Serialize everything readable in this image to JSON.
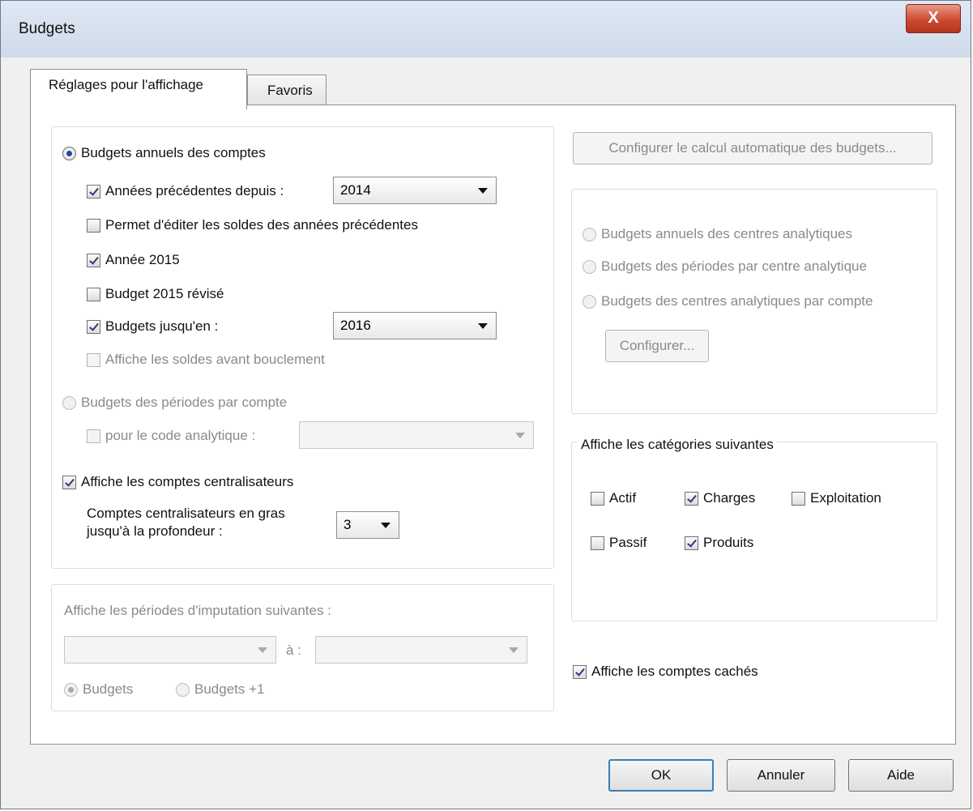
{
  "window": {
    "title": "Budgets",
    "close_label": "X"
  },
  "tabs": [
    "Réglages pour l'affichage",
    "Favoris"
  ],
  "left": {
    "annual": {
      "label": "Budgets annuels des comptes",
      "selected": true
    },
    "prev_years": {
      "label": "Années précédentes depuis :",
      "checked": true,
      "value": "2014"
    },
    "edit_prev": {
      "label": "Permet d'éditer les soldes des années précédentes",
      "checked": false
    },
    "year": {
      "label": "Année 2015",
      "checked": true
    },
    "revised": {
      "label": "Budget 2015 révisé",
      "checked": false
    },
    "until": {
      "label": "Budgets jusqu'en :",
      "checked": true,
      "value": "2016"
    },
    "before_close": {
      "label": "Affiche les soldes avant bouclement",
      "checked": false,
      "disabled": true
    },
    "periods": {
      "label": "Budgets des périodes par compte",
      "selected": false,
      "disabled": true
    },
    "analytic": {
      "label": "pour le code analytique :",
      "checked": false,
      "disabled": true,
      "value": ""
    },
    "central": {
      "label": "Affiche les comptes centralisateurs",
      "checked": true
    },
    "bold_line1": "Comptes centralisateurs en gras",
    "bold_line2": "jusqu'à la profondeur :",
    "depth": "3"
  },
  "imputation": {
    "title": "Affiche les périodes d'imputation suivantes :",
    "from": "",
    "to_label": "à :",
    "to": "",
    "radio_budgets": "Budgets",
    "radio_budgets_plus": "Budgets +1"
  },
  "right": {
    "auto_button": "Configurer le calcul automatique des budgets...",
    "centres": [
      "Budgets annuels des centres analytiques",
      "Budgets des périodes par centre analytique",
      "Budgets des centres analytiques par compte"
    ],
    "configure_button": "Configurer...",
    "categories_title": "Affiche les catégories suivantes",
    "categories": {
      "actif": {
        "label": "Actif",
        "checked": false
      },
      "charges": {
        "label": "Charges",
        "checked": true
      },
      "exploitation": {
        "label": "Exploitation",
        "checked": false
      },
      "passif": {
        "label": "Passif",
        "checked": false
      },
      "produits": {
        "label": "Produits",
        "checked": true
      }
    },
    "hidden": {
      "label": "Affiche les comptes cachés",
      "checked": true
    }
  },
  "footer": {
    "ok": "OK",
    "cancel": "Annuler",
    "help": "Aide"
  }
}
